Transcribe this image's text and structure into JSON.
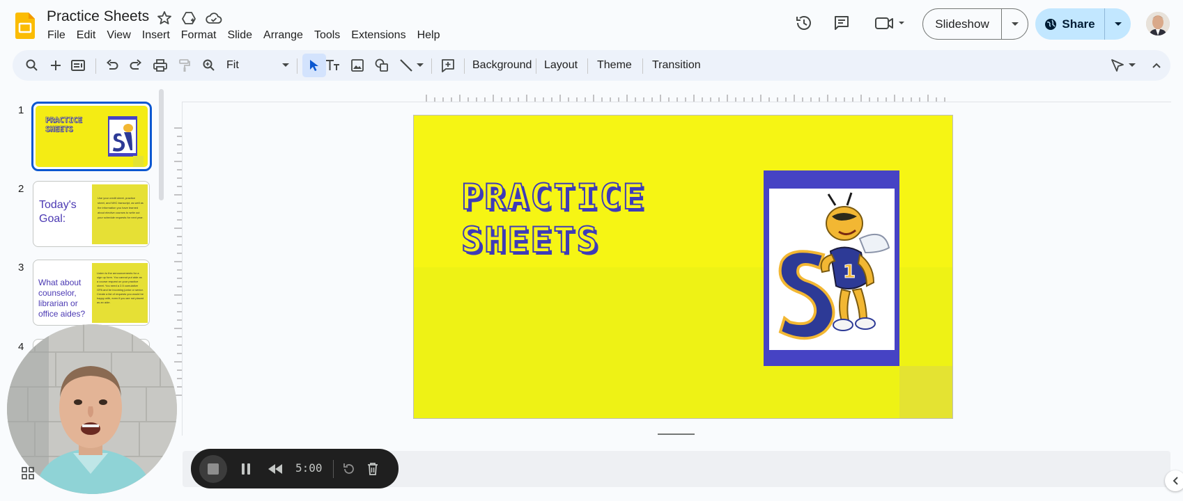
{
  "header": {
    "doc_title": "Practice Sheets",
    "menu": [
      "File",
      "Edit",
      "View",
      "Insert",
      "Format",
      "Slide",
      "Arrange",
      "Tools",
      "Extensions",
      "Help"
    ],
    "slideshow_label": "Slideshow",
    "share_label": "Share",
    "icons": [
      "star-icon",
      "move-to-drive-icon",
      "cloud-saved-icon",
      "version-history-icon",
      "comments-icon",
      "meet-icon"
    ]
  },
  "toolbar": {
    "zoom_value": "Fit",
    "background_label": "Background",
    "layout_label": "Layout",
    "theme_label": "Theme",
    "transition_label": "Transition"
  },
  "filmstrip": {
    "slides": [
      {
        "number": "1",
        "title": "PRACTICE SHEETS"
      },
      {
        "number": "2",
        "title": "Today's Goal:",
        "body": "Use your credit sheet, practice sheet, and NHC transcript, as well as the information you have learned about elective courses to write out your schedule requests for next year."
      },
      {
        "number": "3",
        "title": "What about counselor, librarian or office aides?",
        "body": "Listen to the announcements for a sign up form. You cannot put aide as a course request on your practice sheet. You need a 2.5 cumulative GPA and be incoming junior or senior. Create a list of requests you would be happy with, even if you are not placed as an aide."
      },
      {
        "number": "4"
      }
    ]
  },
  "slide": {
    "title_line1": "PRACTICE",
    "title_line2": "SHEETS",
    "colors": {
      "background": "#f6f514",
      "frame": "#4643c4",
      "title_outline": "#3e3bb8"
    }
  },
  "recorder": {
    "timer": "5:00"
  }
}
